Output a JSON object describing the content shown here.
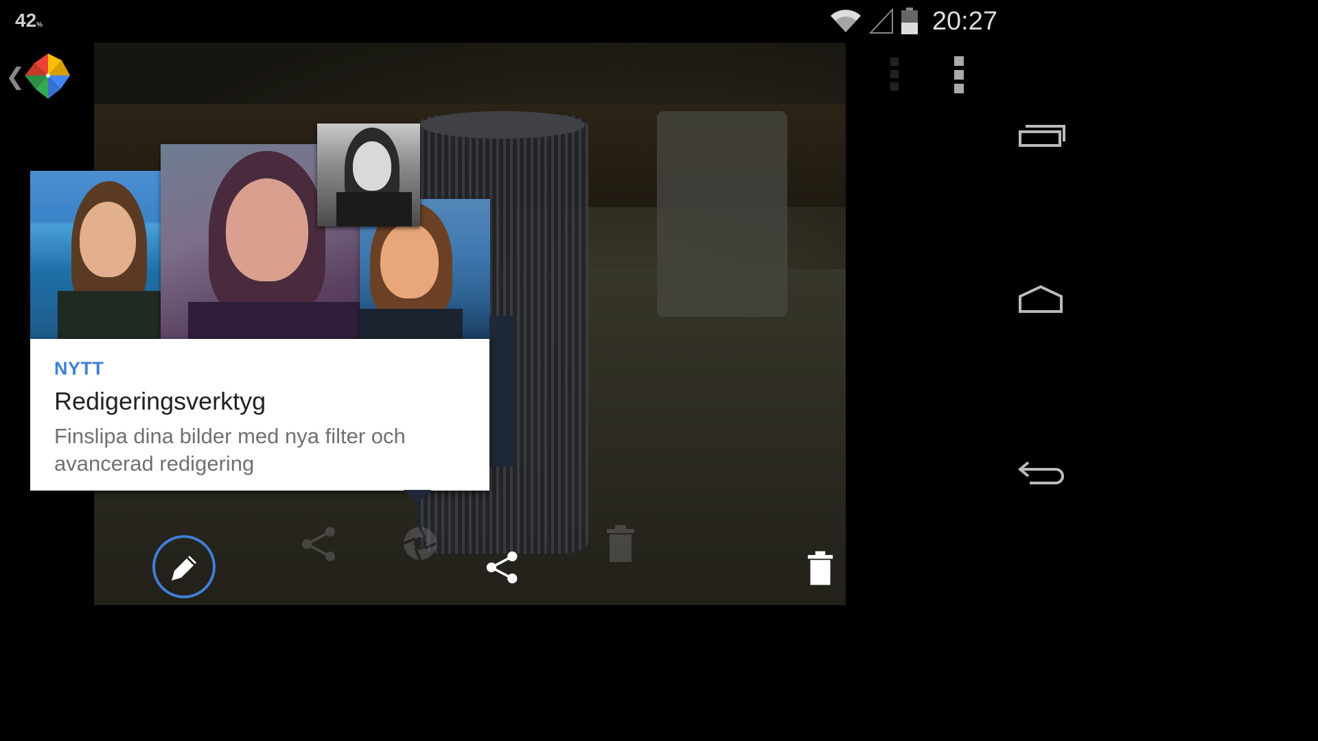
{
  "status_bar": {
    "notification_count": "42",
    "notification_suffix": "%",
    "time": "20:27",
    "icons": [
      "wifi-icon",
      "cell-signal-icon",
      "battery-icon"
    ]
  },
  "action_bar": {
    "app_icon": "google-photos-pinwheel-icon",
    "up_icon": "chevron-left-icon",
    "overflow_icon": "more-vertical-icon"
  },
  "tooltip": {
    "badge": "NYTT",
    "title": "Redigeringsverktyg",
    "description": "Finslipa dina bilder med nya filter och avancerad redigering"
  },
  "toolbar": {
    "icons": [
      "edit-pencil-icon",
      "share-icon",
      "delete-icon"
    ],
    "ghost_icons": [
      "share-icon",
      "aperture-icon",
      "delete-icon"
    ]
  },
  "nav_bar": {
    "icons": [
      "recent-apps-icon",
      "home-icon",
      "back-icon"
    ]
  },
  "colors": {
    "accent_blue": "#3f7fd6",
    "card_background": "#ffffff",
    "title_text": "#222222",
    "description_text": "#707070"
  }
}
